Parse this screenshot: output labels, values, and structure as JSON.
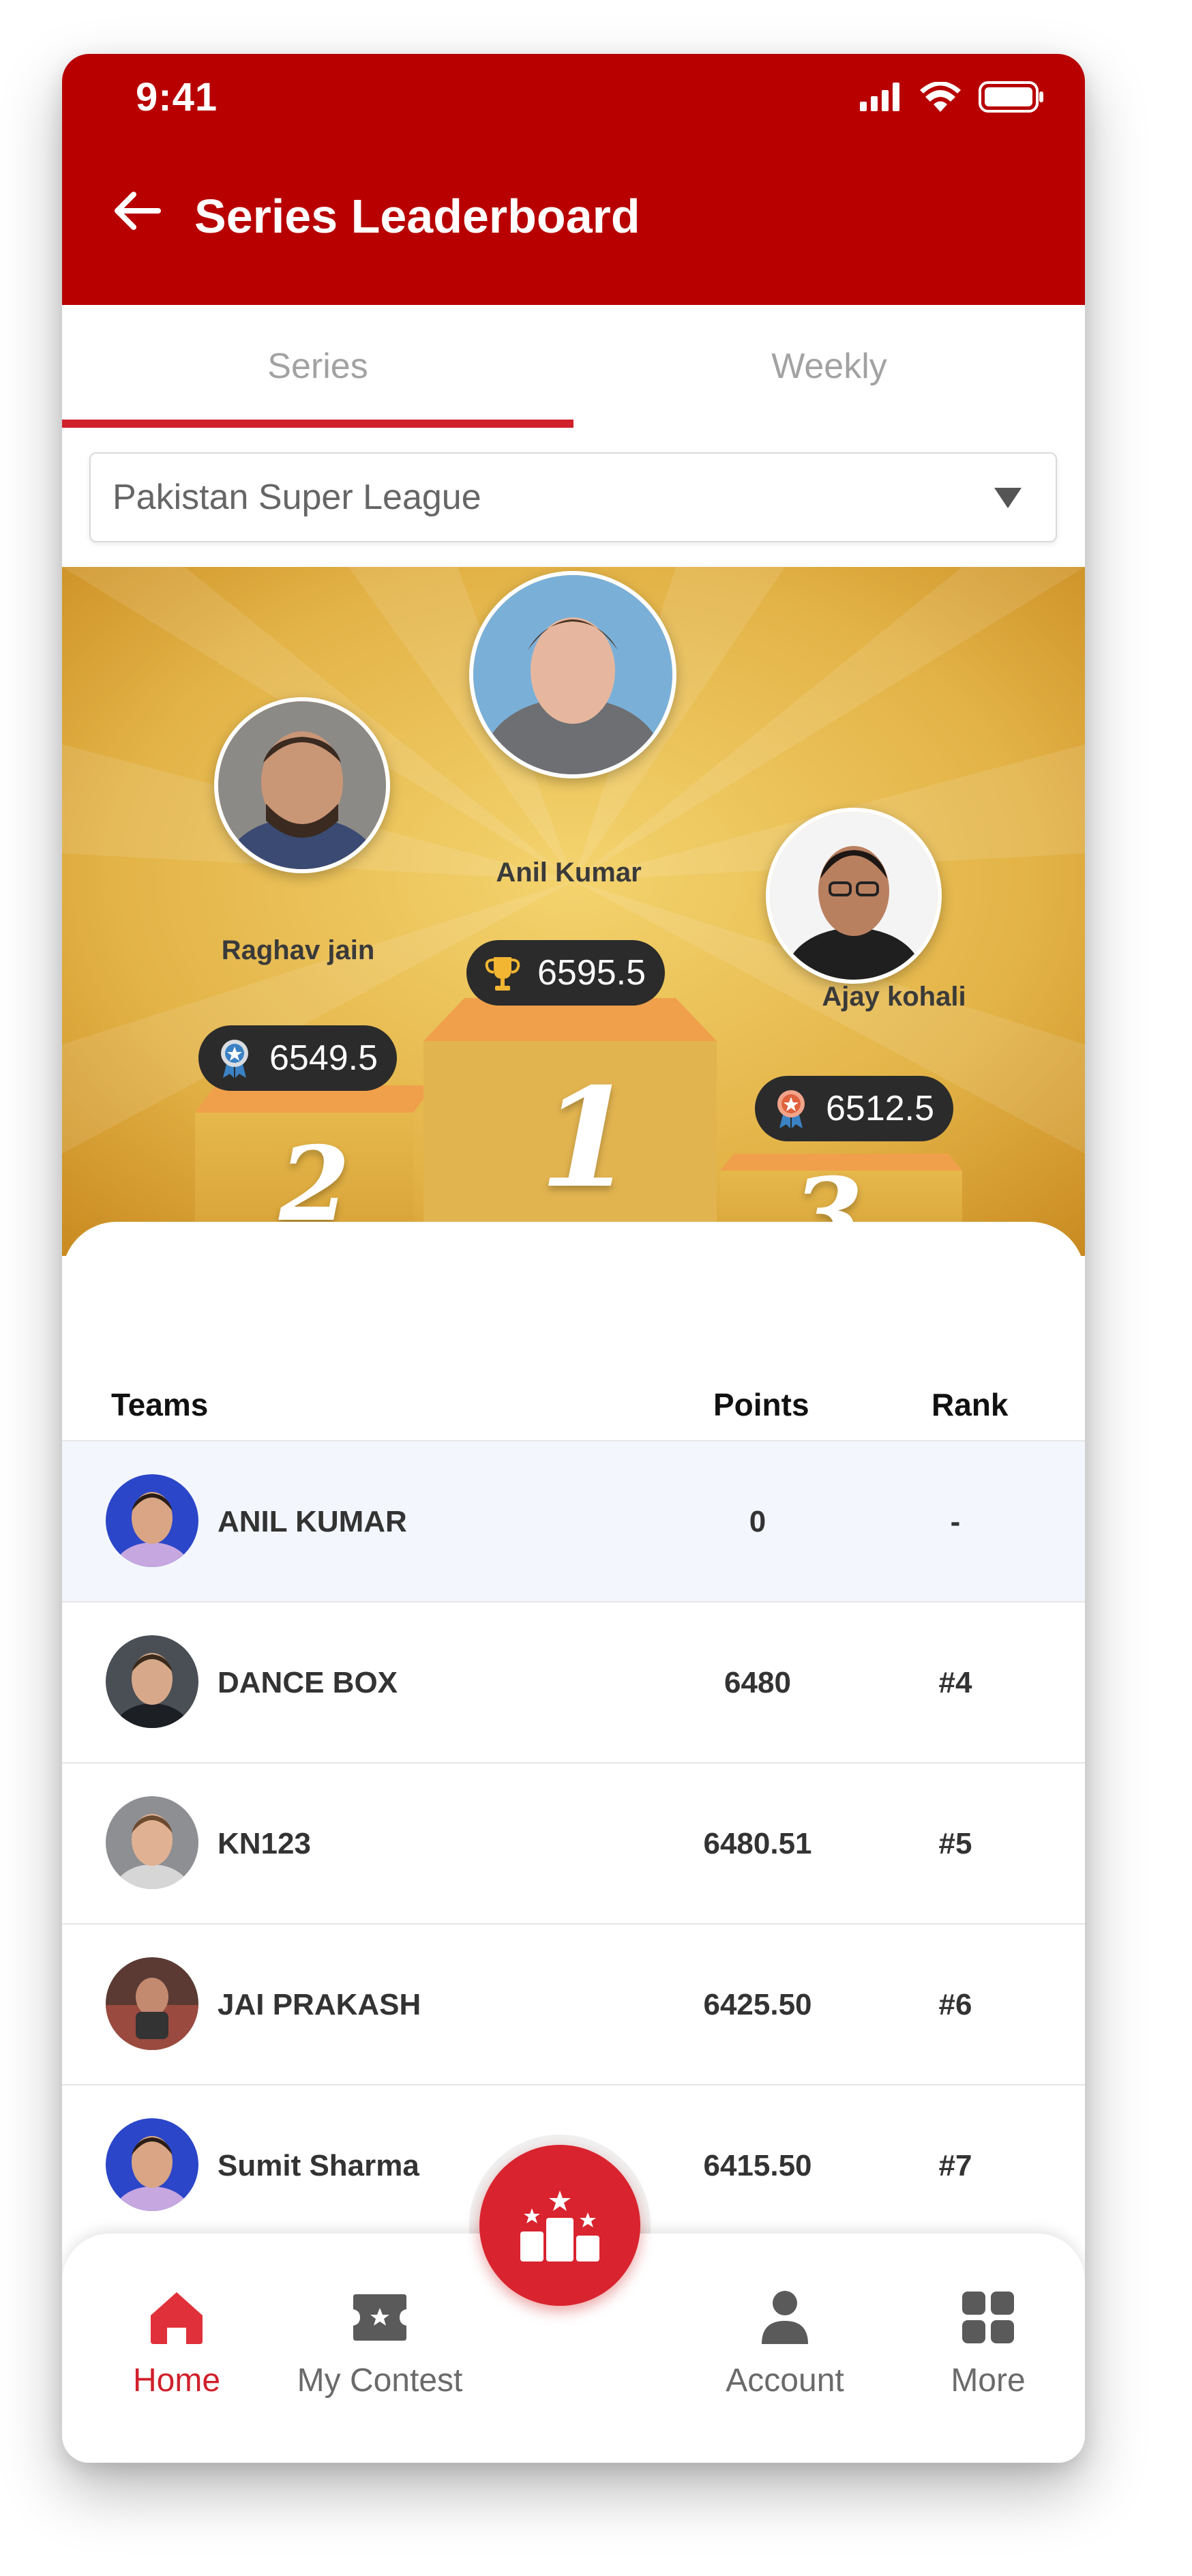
{
  "status_bar": {
    "time": "9:41"
  },
  "header": {
    "title": "Series Leaderboard"
  },
  "tabs": [
    {
      "label": "Series",
      "active": true
    },
    {
      "label": "Weekly",
      "active": false
    }
  ],
  "league_select": {
    "value": "Pakistan Super League"
  },
  "podium": {
    "first": {
      "name": "Anil Kumar",
      "score": "6595.5",
      "rank": "1",
      "medal": "trophy-icon"
    },
    "second": {
      "name": "Raghav jain",
      "score": "6549.5",
      "rank": "2",
      "medal": "silver-medal-icon"
    },
    "third": {
      "name": "Ajay kohali",
      "score": "6512.5",
      "rank": "3",
      "medal": "bronze-medal-icon"
    }
  },
  "table": {
    "headers": {
      "teams": "Teams",
      "points": "Points",
      "rank": "Rank"
    },
    "rows": [
      {
        "name": "ANIL KUMAR",
        "points": "0",
        "rank": "-"
      },
      {
        "name": "DANCE BOX",
        "points": "6480",
        "rank": "#4"
      },
      {
        "name": "KN123",
        "points": "6480.51",
        "rank": "#5"
      },
      {
        "name": "JAI PRAKASH",
        "points": "6425.50",
        "rank": "#6"
      },
      {
        "name": "Sumit Sharma",
        "points": "6415.50",
        "rank": "#7"
      }
    ]
  },
  "bottom_nav": {
    "home": "Home",
    "my_contest": "My Contest",
    "account": "Account",
    "more": "More",
    "center_icon": "leaderboard-podium-icon"
  },
  "colors": {
    "brand_red": "#b80000",
    "accent_red": "#d0202b",
    "podium_gold": "#e3b347",
    "pill_dark": "#2b2b2b"
  }
}
